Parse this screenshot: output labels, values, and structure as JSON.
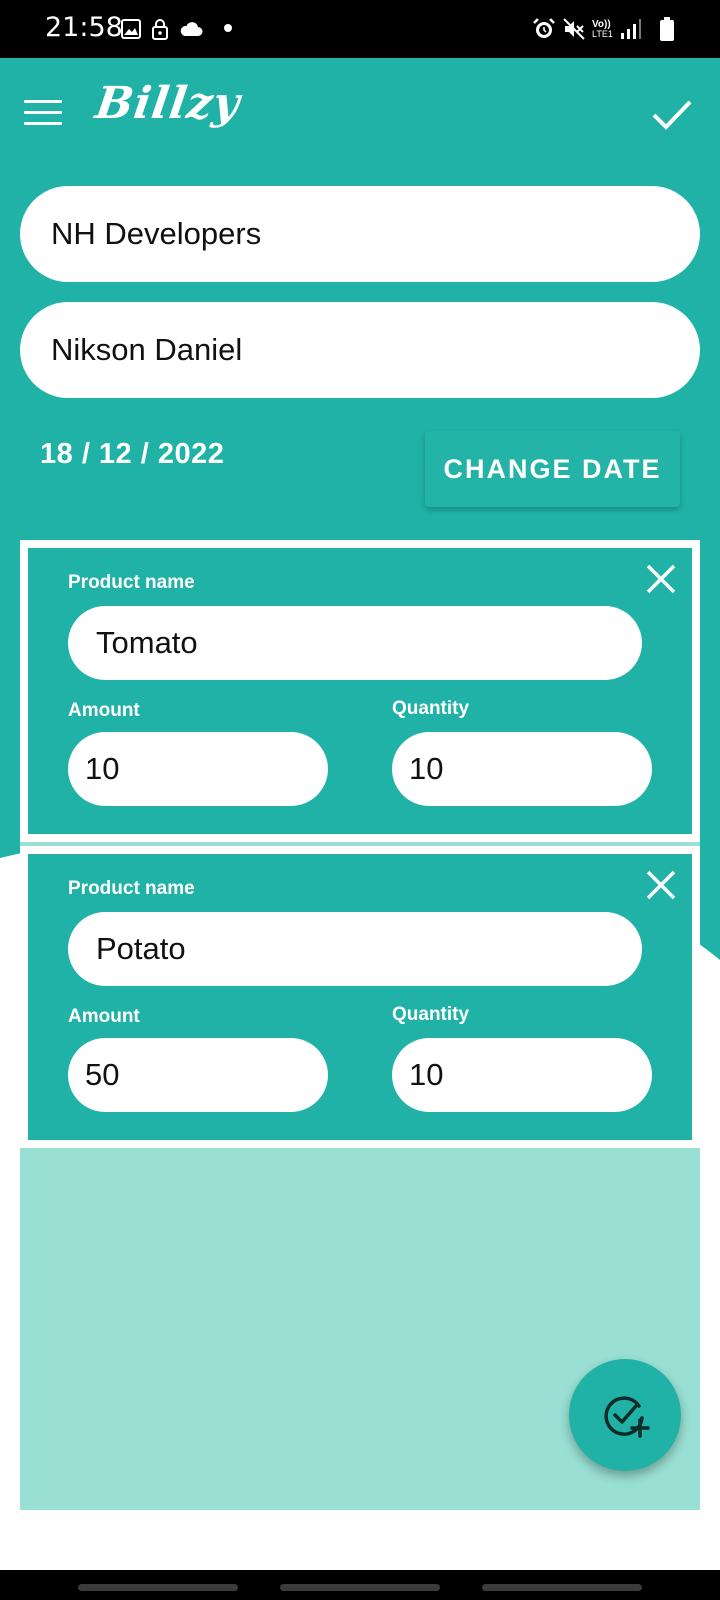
{
  "status_bar": {
    "time": "21:58",
    "icons_left": [
      "image-icon",
      "lock-icon",
      "cloud-icon",
      "dot-icon"
    ],
    "icons_right": [
      "alarm-icon",
      "mute-icon",
      "volte-icon",
      "signal-icon",
      "battery-icon"
    ],
    "volte_label_top": "Vo))",
    "volte_label_bottom": "LTE1"
  },
  "app_bar": {
    "title": "Billzy",
    "menu_icon": "menu-icon",
    "confirm_icon": "check-icon"
  },
  "form": {
    "company_value": "NH Developers",
    "customer_value": "Nikson Daniel",
    "date": "18 / 12 / 2022",
    "change_date_label": "CHANGE DATE"
  },
  "products": [
    {
      "product_name_label": "Product name",
      "product_name": "Tomato",
      "amount_label": "Amount",
      "amount": "10",
      "quantity_label": "Quantity",
      "quantity": "10"
    },
    {
      "product_name_label": "Product name",
      "product_name": "Potato",
      "amount_label": "Amount",
      "amount": "50",
      "quantity_label": "Quantity",
      "quantity": "10"
    }
  ],
  "fab": {
    "icon": "check-add-icon"
  },
  "colors": {
    "primary": "#20b2a6",
    "list_background": "#99dfd3",
    "white": "#ffffff",
    "status_bar": "#000000"
  }
}
